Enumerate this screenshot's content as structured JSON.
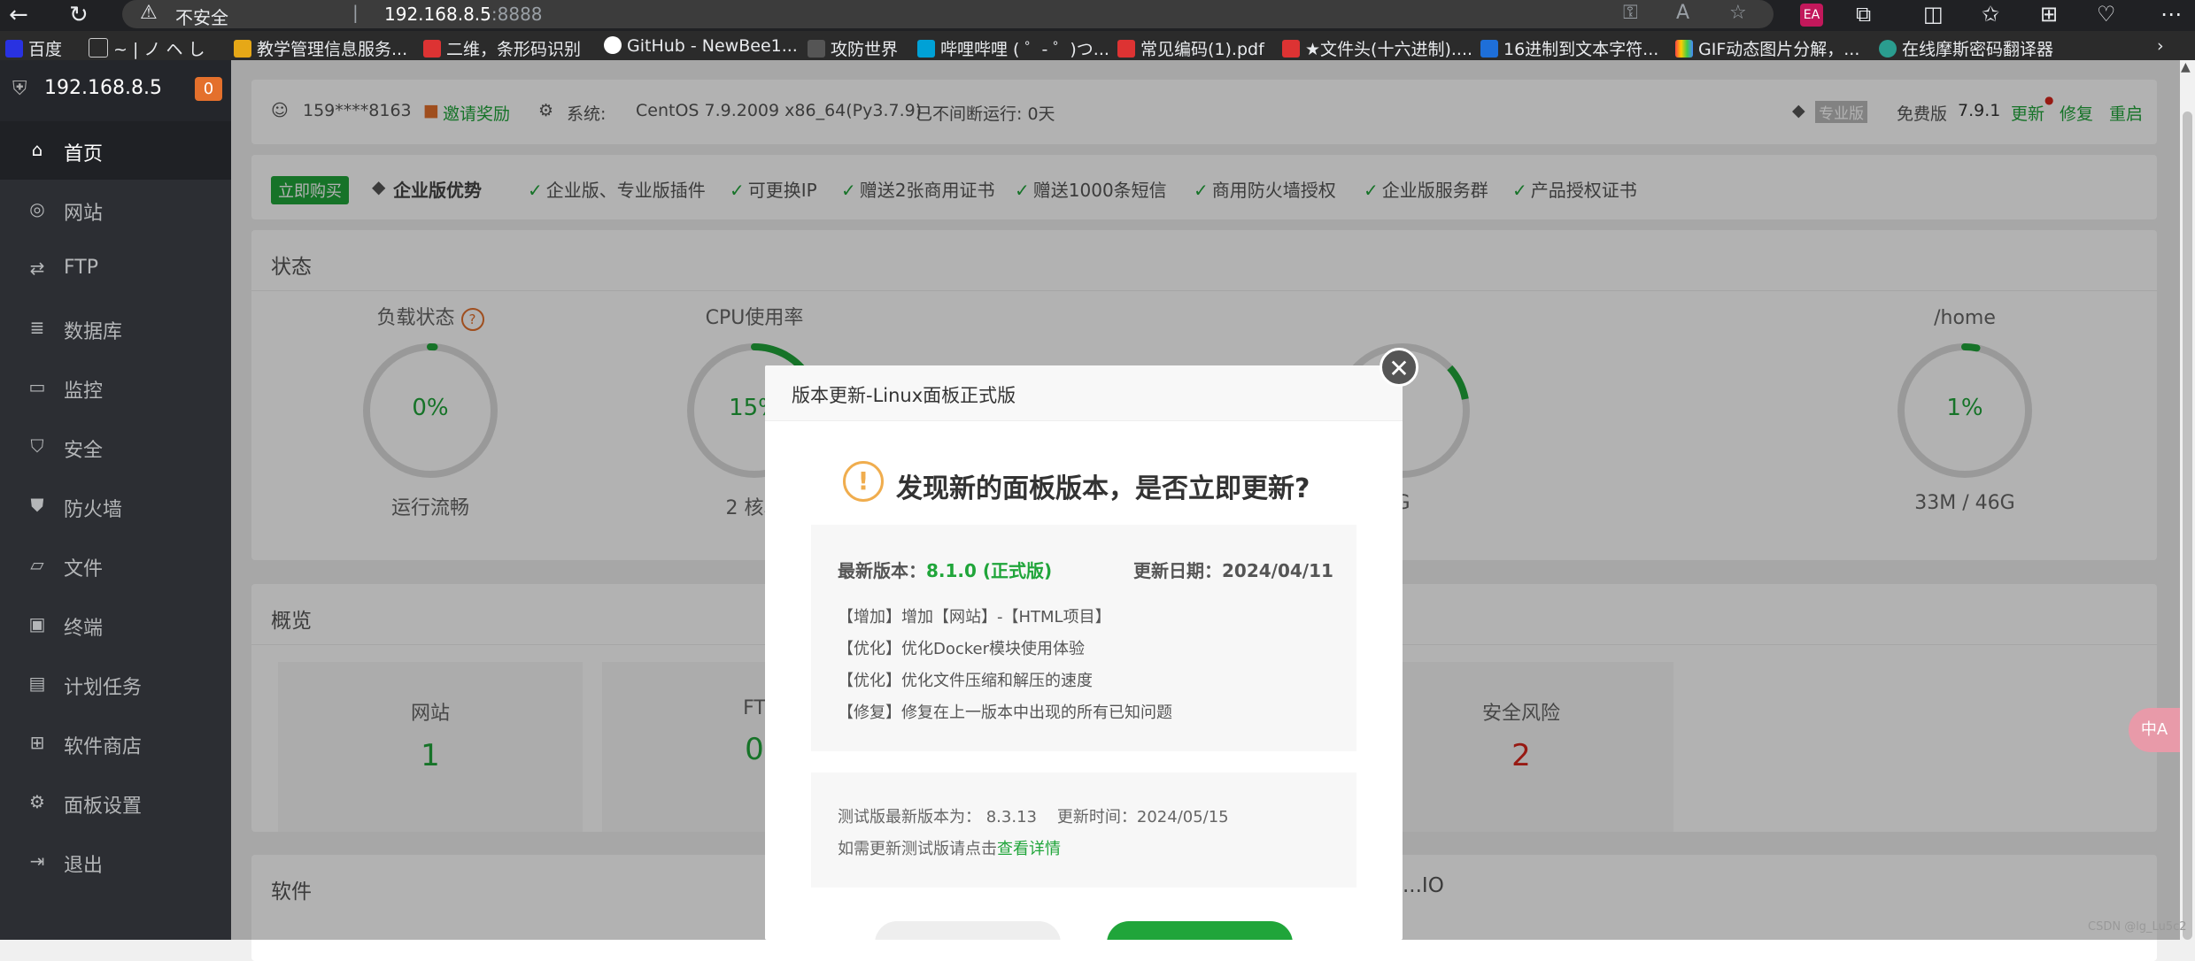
{
  "browser": {
    "insecure_label": "不安全",
    "url_host": "192.168.8.5",
    "url_port": ":8888",
    "ext_badge": "EA",
    "bookmarks": [
      "百度",
      "~ | ノ ヘ し",
      "教学管理信息服务...",
      "二维，条形码识别",
      "GitHub - NewBee1...",
      "攻防世界",
      "哔哩哔哩 ( ゜- ゜)つ...",
      "常见编码(1).pdf",
      "★文件头(十六进制)....",
      "16进制到文本字符...",
      "GIF动态图片分解，...",
      "在线摩斯密码翻译器"
    ]
  },
  "sidebar": {
    "host": "192.168.8.5",
    "badge": "0",
    "items": [
      {
        "label": "首页",
        "icon": "home-icon"
      },
      {
        "label": "网站",
        "icon": "globe-icon"
      },
      {
        "label": "FTP",
        "icon": "ftp-icon"
      },
      {
        "label": "数据库",
        "icon": "database-icon"
      },
      {
        "label": "监控",
        "icon": "monitor-icon"
      },
      {
        "label": "安全",
        "icon": "shield-icon"
      },
      {
        "label": "防火墙",
        "icon": "firewall-icon"
      },
      {
        "label": "文件",
        "icon": "folder-icon"
      },
      {
        "label": "终端",
        "icon": "terminal-icon"
      },
      {
        "label": "计划任务",
        "icon": "calendar-icon"
      },
      {
        "label": "软件商店",
        "icon": "grid-icon"
      },
      {
        "label": "面板设置",
        "icon": "gear-icon"
      },
      {
        "label": "退出",
        "icon": "logout-icon"
      }
    ]
  },
  "topbar": {
    "user": "159****8163",
    "invite": "邀请奖励",
    "system_label": "系统:",
    "system_value": "CentOS 7.9.2009 x86_64(Py3.7.9)",
    "uptime": "已不间断运行: 0天",
    "pro": "专业版",
    "free": "免费版",
    "version": "7.9.1",
    "update": "更新",
    "repair": "修复",
    "restart": "重启"
  },
  "vip": {
    "buy": "立即购买",
    "title": "企业版优势",
    "features": [
      "企业版、专业版插件",
      "可更换IP",
      "赠送2张商用证书",
      "赠送1000条短信",
      "商用防火墙授权",
      "企业版服务群",
      "产品授权证书"
    ]
  },
  "status": {
    "title": "状态",
    "gauges": [
      {
        "label": "负载状态",
        "value": "0%",
        "sub": "运行流畅",
        "fraction": 0.0
      },
      {
        "label": "CPU使用率",
        "value": "15%",
        "sub": "2 核心",
        "fraction": 0.15
      },
      {
        "label": "/home",
        "value": "1%",
        "sub": "33M / 46G",
        "fraction": 0.01
      }
    ],
    "hidden_sub": "G"
  },
  "overview": {
    "title": "概览",
    "items": [
      {
        "label": "网站",
        "value": "1"
      },
      {
        "label": "FT",
        "value": "0"
      },
      {
        "label": "安全风险",
        "value": "2"
      }
    ]
  },
  "next_section": {
    "title": "软件",
    "right": "...IO"
  },
  "dialog": {
    "title": "版本更新-Linux面板正式版",
    "headline": "发现新的面板版本，是否立即更新?",
    "latest_label": "最新版本：",
    "latest_version": "8.1.0 (正式版)",
    "date_label": "更新日期：",
    "date_value": "2024/04/11",
    "notes": [
      "【增加】增加【网站】-【HTML项目】",
      "【优化】优化Docker模块使用体验",
      "【优化】优化文件压缩和解压的速度",
      "【修复】修复在上一版本中出现的所有已知问题"
    ],
    "test_label": "测试版最新版本为：",
    "test_version": "8.3.13",
    "test_time_label": "更新时间：",
    "test_time": "2024/05/15",
    "test_hint": "如需更新测试版请点击",
    "test_link": "查看详情"
  },
  "translate_fab": "中A",
  "watermark": "CSDN @lg_Lu5c2",
  "colors": {
    "accent": "#20a53a",
    "danger": "#d9261c",
    "warning": "#f0ad4e",
    "sidebar": "#2c2e33"
  }
}
